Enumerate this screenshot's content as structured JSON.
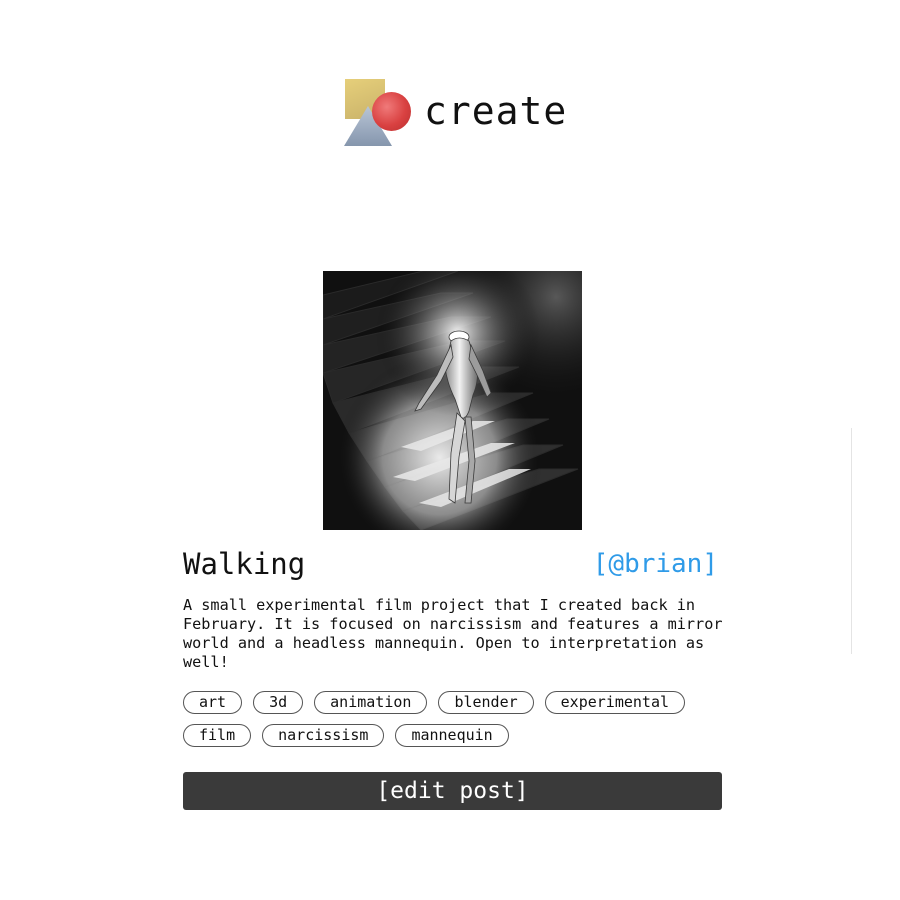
{
  "app": {
    "name": "create"
  },
  "post": {
    "title": "Walking",
    "author": "[@brian]",
    "description": "A small experimental film project that I created back in February. It is focused on narcissism and features a mirror world and a headless mannequin. Open to interpretation as well!",
    "tags": [
      "art",
      "3d",
      "animation",
      "blender",
      "experimental",
      "film",
      "narcissism",
      "mannequin"
    ],
    "edit_label": "[edit post]"
  },
  "colors": {
    "author_link": "#2f9be8",
    "button_bg": "#3a3a3a",
    "logo_square": "#e6cf7a",
    "logo_circle": "#d94141",
    "logo_triangle": "#9fb0c6"
  }
}
